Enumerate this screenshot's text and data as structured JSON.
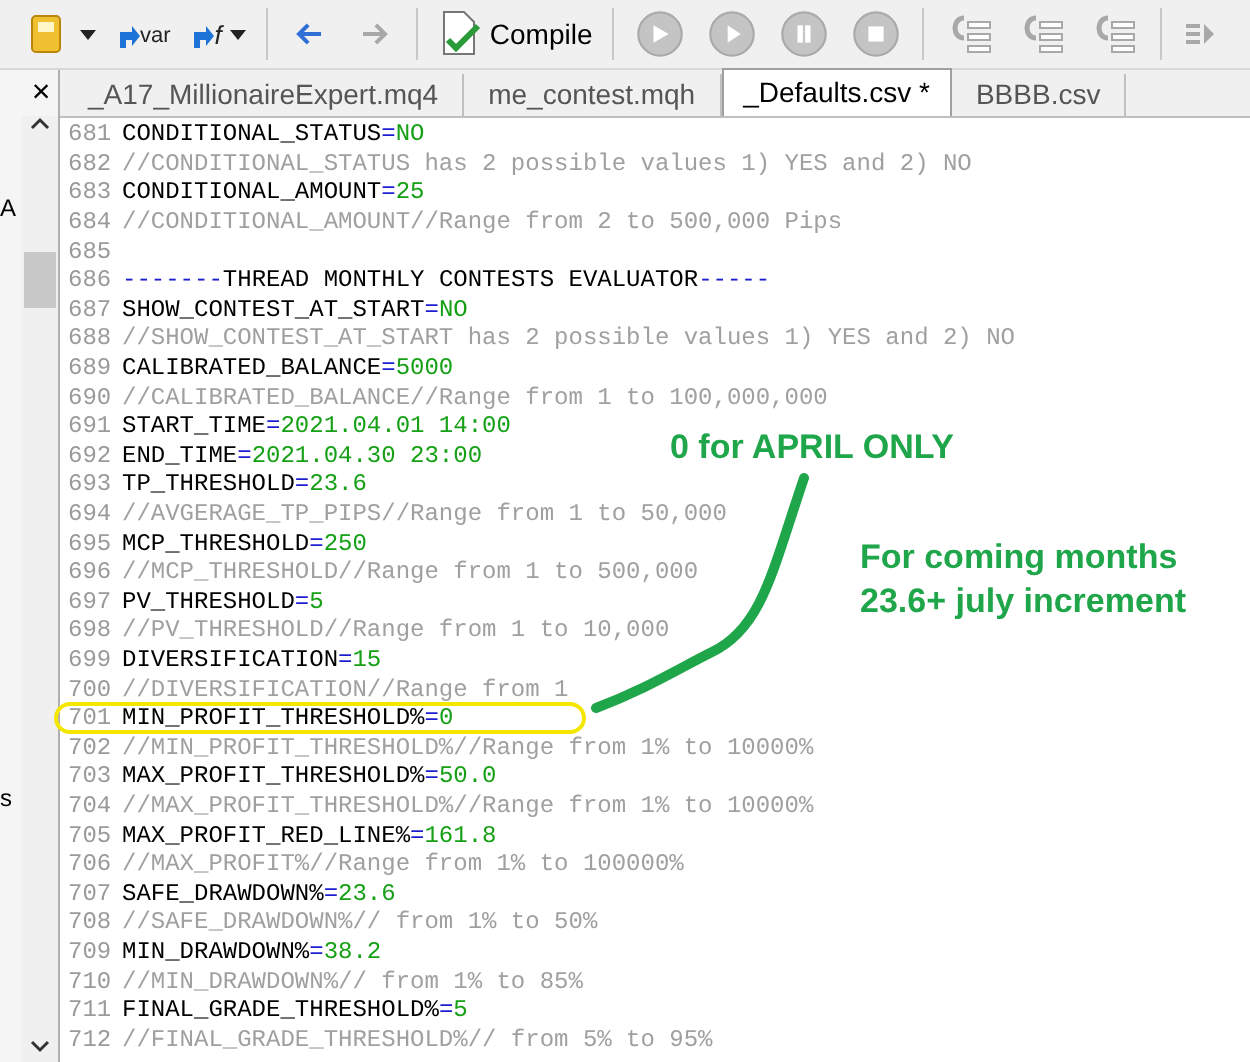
{
  "toolbar": {
    "items": [
      {
        "kind": "book",
        "dropdown": true
      },
      {
        "kind": "var",
        "label": "var"
      },
      {
        "kind": "function",
        "label": "f",
        "dropdown": true
      },
      {
        "kind": "separator"
      },
      {
        "kind": "back",
        "disabled": false
      },
      {
        "kind": "forward",
        "disabled": true
      },
      {
        "kind": "separator"
      },
      {
        "kind": "compile",
        "label": "Compile"
      },
      {
        "kind": "separator"
      },
      {
        "kind": "restart",
        "disabled": true
      },
      {
        "kind": "play",
        "disabled": true
      },
      {
        "kind": "pause",
        "disabled": true
      },
      {
        "kind": "stop",
        "disabled": true
      },
      {
        "kind": "separator"
      },
      {
        "kind": "stepin",
        "disabled": true
      },
      {
        "kind": "stepover",
        "disabled": true
      },
      {
        "kind": "stepout",
        "disabled": true
      },
      {
        "kind": "separator"
      },
      {
        "kind": "indent",
        "disabled": true
      }
    ]
  },
  "side_panel": {
    "close": "×",
    "fragments": [
      "A",
      "s"
    ]
  },
  "tabs": [
    {
      "label": "_A17_MillionaireExpert.mq4",
      "selected": false
    },
    {
      "label": "me_contest.mqh",
      "selected": false
    },
    {
      "label": "_Defaults.csv *",
      "selected": true
    },
    {
      "label": "BBBB.csv",
      "selected": false
    }
  ],
  "editor": {
    "lines": [
      {
        "number": "681",
        "kind": "setting",
        "key": "CONDITIONAL_STATUS",
        "assign": "=",
        "value": "NO"
      },
      {
        "number": "682",
        "kind": "comment",
        "text": "//CONDITIONAL_STATUS has 2 possible values 1) YES and 2) NO"
      },
      {
        "number": "683",
        "kind": "setting",
        "key": "CONDITIONAL_AMOUNT",
        "assign": "=",
        "value": "25"
      },
      {
        "number": "684",
        "kind": "comment",
        "text": "//CONDITIONAL_AMOUNT//Range from 2 to 500,000 Pips"
      },
      {
        "number": "685",
        "kind": "blank"
      },
      {
        "number": "686",
        "kind": "heading",
        "lead": "-------",
        "title": "THREAD MONTHLY CONTESTS EVALUATOR",
        "trail": "-----"
      },
      {
        "number": "687",
        "kind": "setting",
        "key": "SHOW_CONTEST_AT_START",
        "assign": "=",
        "value": "NO"
      },
      {
        "number": "688",
        "kind": "comment",
        "text": "//SHOW_CONTEST_AT_START has 2 possible values 1) YES and 2) NO"
      },
      {
        "number": "689",
        "kind": "setting",
        "key": "CALIBRATED_BALANCE",
        "assign": "=",
        "value": "5000"
      },
      {
        "number": "690",
        "kind": "comment",
        "text": "//CALIBRATED_BALANCE//Range from 1 to 100,000,000"
      },
      {
        "number": "691",
        "kind": "setting",
        "key": "START_TIME",
        "assign": "=",
        "value": "2021.04.01 14:00"
      },
      {
        "number": "692",
        "kind": "setting",
        "key": "END_TIME",
        "assign": "=",
        "value": "2021.04.30 23:00"
      },
      {
        "number": "693",
        "kind": "setting",
        "key": "TP_THRESHOLD",
        "assign": "=",
        "value": "23.6"
      },
      {
        "number": "694",
        "kind": "comment",
        "text": "//AVGERAGE_TP_PIPS//Range from 1 to 50,000"
      },
      {
        "number": "695",
        "kind": "setting",
        "key": "MCP_THRESHOLD",
        "assign": "=",
        "value": "250"
      },
      {
        "number": "696",
        "kind": "comment",
        "text": "//MCP_THRESHOLD//Range from 1 to 500,000"
      },
      {
        "number": "697",
        "kind": "setting",
        "key": "PV_THRESHOLD",
        "assign": "=",
        "value": "5"
      },
      {
        "number": "698",
        "kind": "comment",
        "text": "//PV_THRESHOLD//Range from 1 to 10,000"
      },
      {
        "number": "699",
        "kind": "setting",
        "key": "DIVERSIFICATION",
        "assign": "=",
        "value": "15"
      },
      {
        "number": "700",
        "kind": "comment",
        "text": "//DIVERSIFICATION//Range from 1"
      },
      {
        "number": "701",
        "kind": "setting",
        "key": "MIN_PROFIT_THRESHOLD%",
        "assign": "=",
        "value": "0"
      },
      {
        "number": "702",
        "kind": "comment",
        "text": "//MIN_PROFIT_THRESHOLD%//Range from 1% to 10000%"
      },
      {
        "number": "703",
        "kind": "setting",
        "key": "MAX_PROFIT_THRESHOLD%",
        "assign": "=",
        "value": "50.0"
      },
      {
        "number": "704",
        "kind": "comment",
        "text": "//MAX_PROFIT_THRESHOLD%//Range from 1% to 10000%"
      },
      {
        "number": "705",
        "kind": "setting",
        "key": "MAX_PROFIT_RED_LINE%",
        "assign": "=",
        "value": "161.8"
      },
      {
        "number": "706",
        "kind": "comment",
        "text": "//MAX_PROFIT%//Range from 1% to 100000%"
      },
      {
        "number": "707",
        "kind": "setting",
        "key": "SAFE_DRAWDOWN%",
        "assign": "=",
        "value": "23.6"
      },
      {
        "number": "708",
        "kind": "comment",
        "text": "//SAFE_DRAWDOWN%// from 1% to 50%"
      },
      {
        "number": "709",
        "kind": "setting",
        "key": "MIN_DRAWDOWN%",
        "assign": "=",
        "value": "38.2"
      },
      {
        "number": "710",
        "kind": "comment",
        "text": "//MIN_DRAWDOWN%// from 1% to 85%"
      },
      {
        "number": "711",
        "kind": "setting",
        "key": "FINAL_GRADE_THRESHOLD%",
        "assign": "=",
        "value": "5"
      },
      {
        "number": "712",
        "kind": "comment",
        "text": "//FINAL_GRADE_THRESHOLD%// from 5% to 95%"
      }
    ]
  },
  "annotations": {
    "note_top": "0 for APRIL ONLY",
    "note_side": "For coming months 23.6+ july increment"
  }
}
